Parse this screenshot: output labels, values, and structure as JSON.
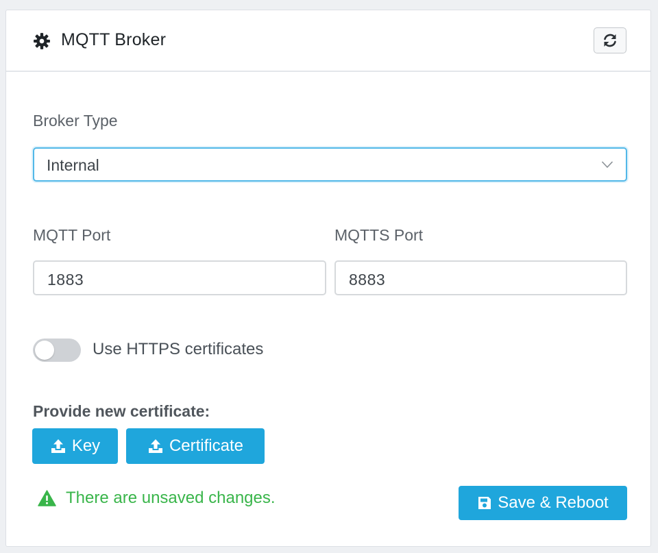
{
  "header": {
    "title": "MQTT Broker",
    "title_icon": "gear-icon",
    "refresh_icon": "refresh-icon"
  },
  "broker_type": {
    "label": "Broker Type",
    "value": "Internal"
  },
  "mqtt_port": {
    "label": "MQTT Port",
    "value": "1883"
  },
  "mqtts_port": {
    "label": "MQTTS Port",
    "value": "8883"
  },
  "https_toggle": {
    "label": "Use HTTPS certificates",
    "checked": false
  },
  "certificate": {
    "label": "Provide new certificate:",
    "key_button": "Key",
    "certificate_button": "Certificate"
  },
  "status": {
    "warning": "There are unsaved changes.",
    "warning_color": "#39b54a"
  },
  "actions": {
    "save_label": "Save & Reboot"
  },
  "colors": {
    "accent": "#1fa6dc",
    "focus_border": "#52b8e8"
  }
}
